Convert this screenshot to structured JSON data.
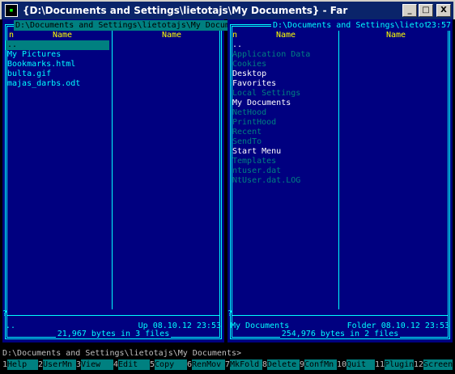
{
  "window": {
    "title": "{D:\\Documents and Settings\\lietotajs\\My Documents} - Far",
    "app_icon": "far-icon",
    "buttons": {
      "minimize": "_",
      "maximize": "□",
      "close": "X"
    }
  },
  "left_panel": {
    "title": "D:\\Documents and Settings\\lietotajs\\My Documents",
    "columns": [
      "n",
      "Name",
      "Name"
    ],
    "items": [
      {
        "name": "..",
        "type": "cursor"
      },
      {
        "name": "My Pictures",
        "type": "dir"
      },
      {
        "name": "Bookmarks.html",
        "type": "file"
      },
      {
        "name": "bulta.gif",
        "type": "file"
      },
      {
        "name": "majas_darbs.odt",
        "type": "file"
      }
    ],
    "status_name": "..",
    "status_info": "Up   08.10.12 23:53",
    "summary": " 21,967 bytes in 3 files ",
    "qmark": "?"
  },
  "right_panel": {
    "title": " D:\\Documents and Settings\\lietotajs ",
    "clock": "23:57",
    "columns": [
      "n",
      "Name",
      "Name"
    ],
    "items": [
      {
        "name": "..",
        "type": "parent"
      },
      {
        "name": "Application Data",
        "type": "hidden"
      },
      {
        "name": "Cookies",
        "type": "hidden"
      },
      {
        "name": "Desktop",
        "type": "dir"
      },
      {
        "name": "Favorites",
        "type": "dir"
      },
      {
        "name": "Local Settings",
        "type": "hidden"
      },
      {
        "name": "My Documents",
        "type": "dir"
      },
      {
        "name": "NetHood",
        "type": "hidden"
      },
      {
        "name": "PrintHood",
        "type": "hidden"
      },
      {
        "name": "Recent",
        "type": "hidden"
      },
      {
        "name": "SendTo",
        "type": "hidden"
      },
      {
        "name": "Start Menu",
        "type": "dir"
      },
      {
        "name": "Templates",
        "type": "hidden"
      },
      {
        "name": "ntuser.dat",
        "type": "hidden"
      },
      {
        "name": "NtUser.dat.LOG",
        "type": "hidden"
      }
    ],
    "status_name": "My Documents",
    "status_info": "Folder 08.10.12 23:53",
    "summary": " 254,976 bytes in 2 files ",
    "qmark": "?"
  },
  "command_line": "D:\\Documents and Settings\\lietotajs\\My Documents>",
  "keybar": [
    {
      "num": "1",
      "label": "Help"
    },
    {
      "num": "2",
      "label": "UserMn"
    },
    {
      "num": "3",
      "label": "View"
    },
    {
      "num": "4",
      "label": "Edit"
    },
    {
      "num": "5",
      "label": "Copy"
    },
    {
      "num": "6",
      "label": "RenMov"
    },
    {
      "num": "7",
      "label": "MkFold"
    },
    {
      "num": "8",
      "label": "Delete"
    },
    {
      "num": "9",
      "label": "ConfMn"
    },
    {
      "num": "10",
      "label": "Quit"
    },
    {
      "num": "11",
      "label": "Plugin"
    },
    {
      "num": "12",
      "label": "Screen"
    }
  ],
  "colors": {
    "panel_bg": "#000080",
    "frame": "#00ffff",
    "header": "#ffff00",
    "cursor": "#008080",
    "dir": "#ffffff",
    "hidden": "#008080",
    "file": "#00ffff"
  }
}
